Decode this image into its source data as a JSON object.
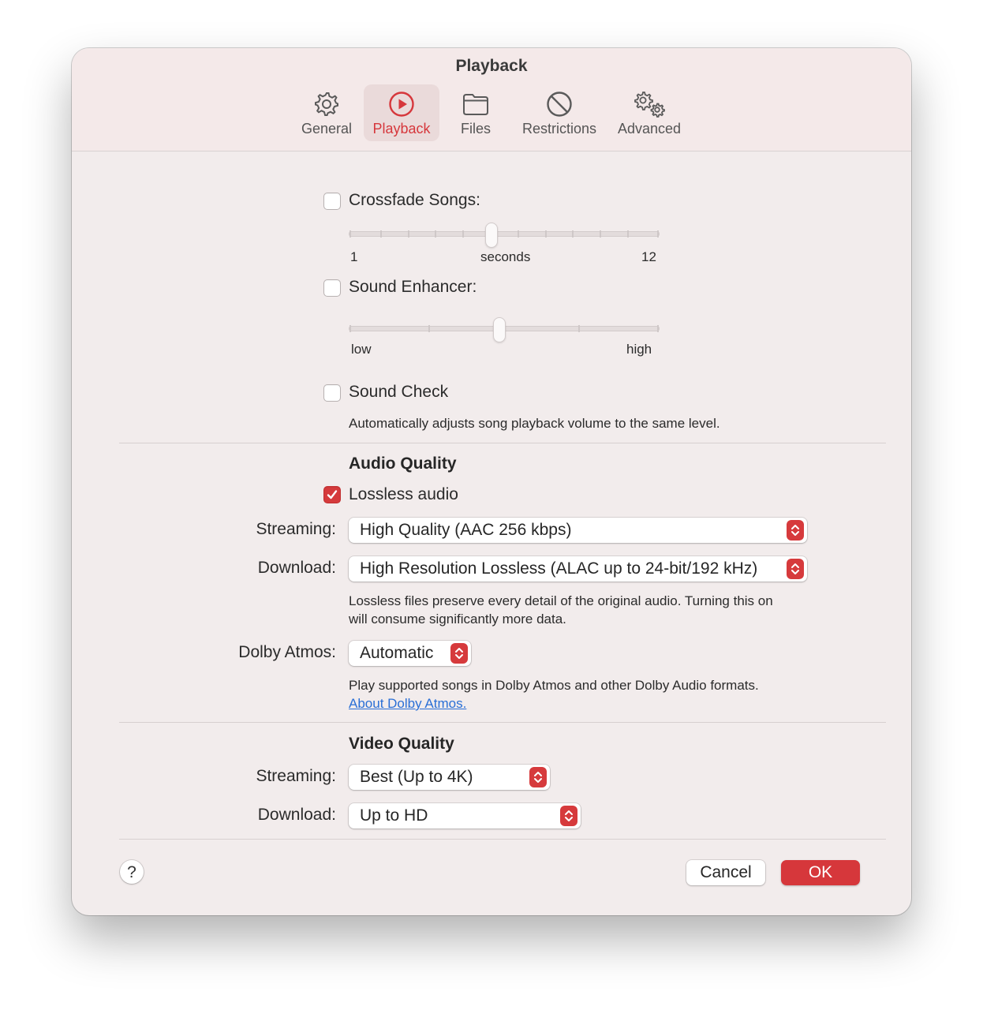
{
  "window": {
    "title": "Playback"
  },
  "tabs": [
    {
      "label": "General",
      "icon": "gear-icon",
      "active": false
    },
    {
      "label": "Playback",
      "icon": "play-circle-icon",
      "active": true
    },
    {
      "label": "Files",
      "icon": "folder-icon",
      "active": false
    },
    {
      "label": "Restrictions",
      "icon": "prohibited-icon",
      "active": false
    },
    {
      "label": "Advanced",
      "icon": "gears-icon",
      "active": false
    }
  ],
  "crossfade": {
    "label": "Crossfade Songs:",
    "checked": false,
    "min_label": "1",
    "unit_label": "seconds",
    "max_label": "12",
    "value": 6
  },
  "sound_enhancer": {
    "label": "Sound Enhancer:",
    "checked": false,
    "low_label": "low",
    "high_label": "high",
    "level": 0.5
  },
  "sound_check": {
    "label": "Sound Check",
    "checked": false,
    "description": "Automatically adjusts song playback volume to the same level."
  },
  "audio_quality": {
    "heading": "Audio Quality",
    "lossless_label": "Lossless audio",
    "lossless_checked": true,
    "streaming_label": "Streaming:",
    "streaming_value": "High Quality (AAC 256 kbps)",
    "download_label": "Download:",
    "download_value": "High Resolution Lossless (ALAC up to 24-bit/192 kHz)",
    "lossless_note_line1": "Lossless files preserve every detail of the original audio. Turning this on",
    "lossless_note_line2": "will consume significantly more data.",
    "dolby_label": "Dolby Atmos:",
    "dolby_value": "Automatic",
    "dolby_note": "Play supported songs in Dolby Atmos and other Dolby Audio formats.",
    "dolby_link": "About Dolby Atmos."
  },
  "video_quality": {
    "heading": "Video Quality",
    "streaming_label": "Streaming:",
    "streaming_value": "Best (Up to 4K)",
    "download_label": "Download:",
    "download_value": "Up to HD"
  },
  "footer": {
    "help_label": "?",
    "cancel_label": "Cancel",
    "ok_label": "OK"
  },
  "colors": {
    "accent": "#d6373b",
    "link": "#2a6fd6",
    "window_bg": "#f2ecec"
  }
}
